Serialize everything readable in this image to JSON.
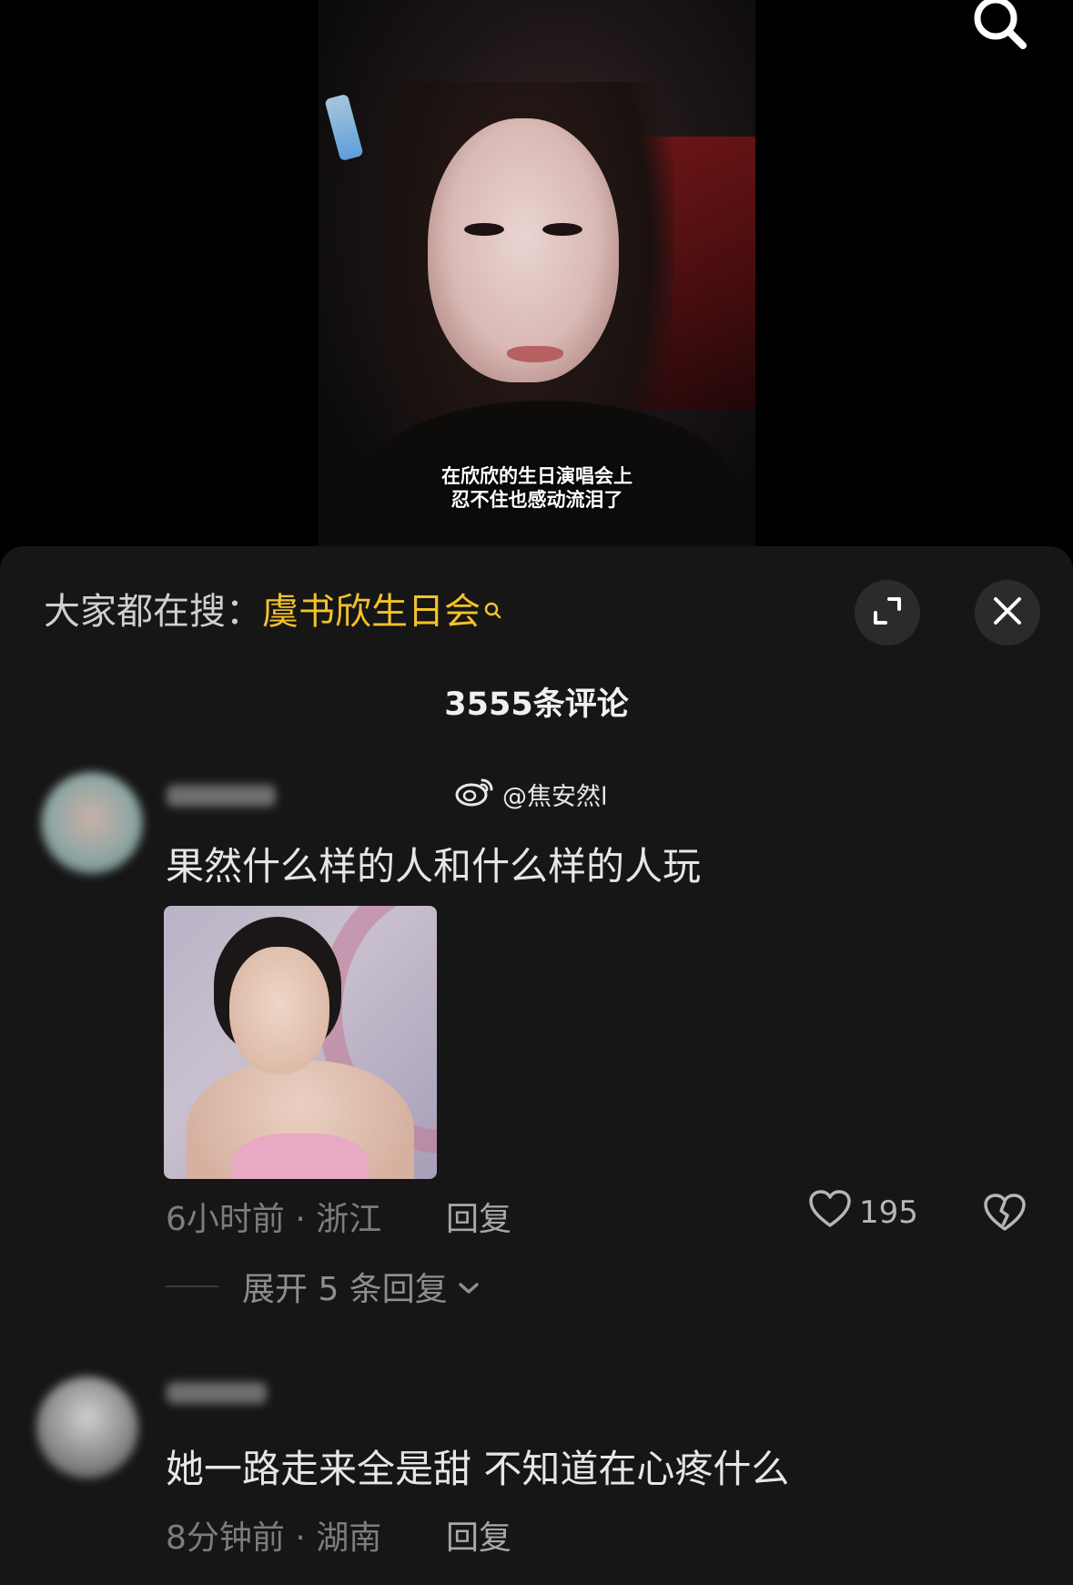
{
  "video": {
    "caption_line1": "在欣欣的生日演唱会上",
    "caption_line2": "忍不住也感动流泪了"
  },
  "top_bar": {
    "search_icon": "search-icon"
  },
  "panel": {
    "trending_prefix": "大家都在搜：",
    "trending_keyword": "虞书欣生日会",
    "expand_icon": "expand-icon",
    "close_icon": "close-icon",
    "comment_count": "3555条评论",
    "watermark": "@焦安然l"
  },
  "comments": [
    {
      "text": "果然什么样的人和什么样的人玩",
      "meta": "6小时前 · 浙江",
      "reply_label": "回复",
      "likes": "195",
      "expand_label": "展开 5 条回复"
    },
    {
      "text": "她一路走来全是甜 不知道在心疼什么",
      "meta": "8分钟前 · 湖南",
      "reply_label": "回复"
    }
  ],
  "colors": {
    "panel_bg": "#161616",
    "keyword": "#f3c12b",
    "muted": "#7d7d7d"
  }
}
